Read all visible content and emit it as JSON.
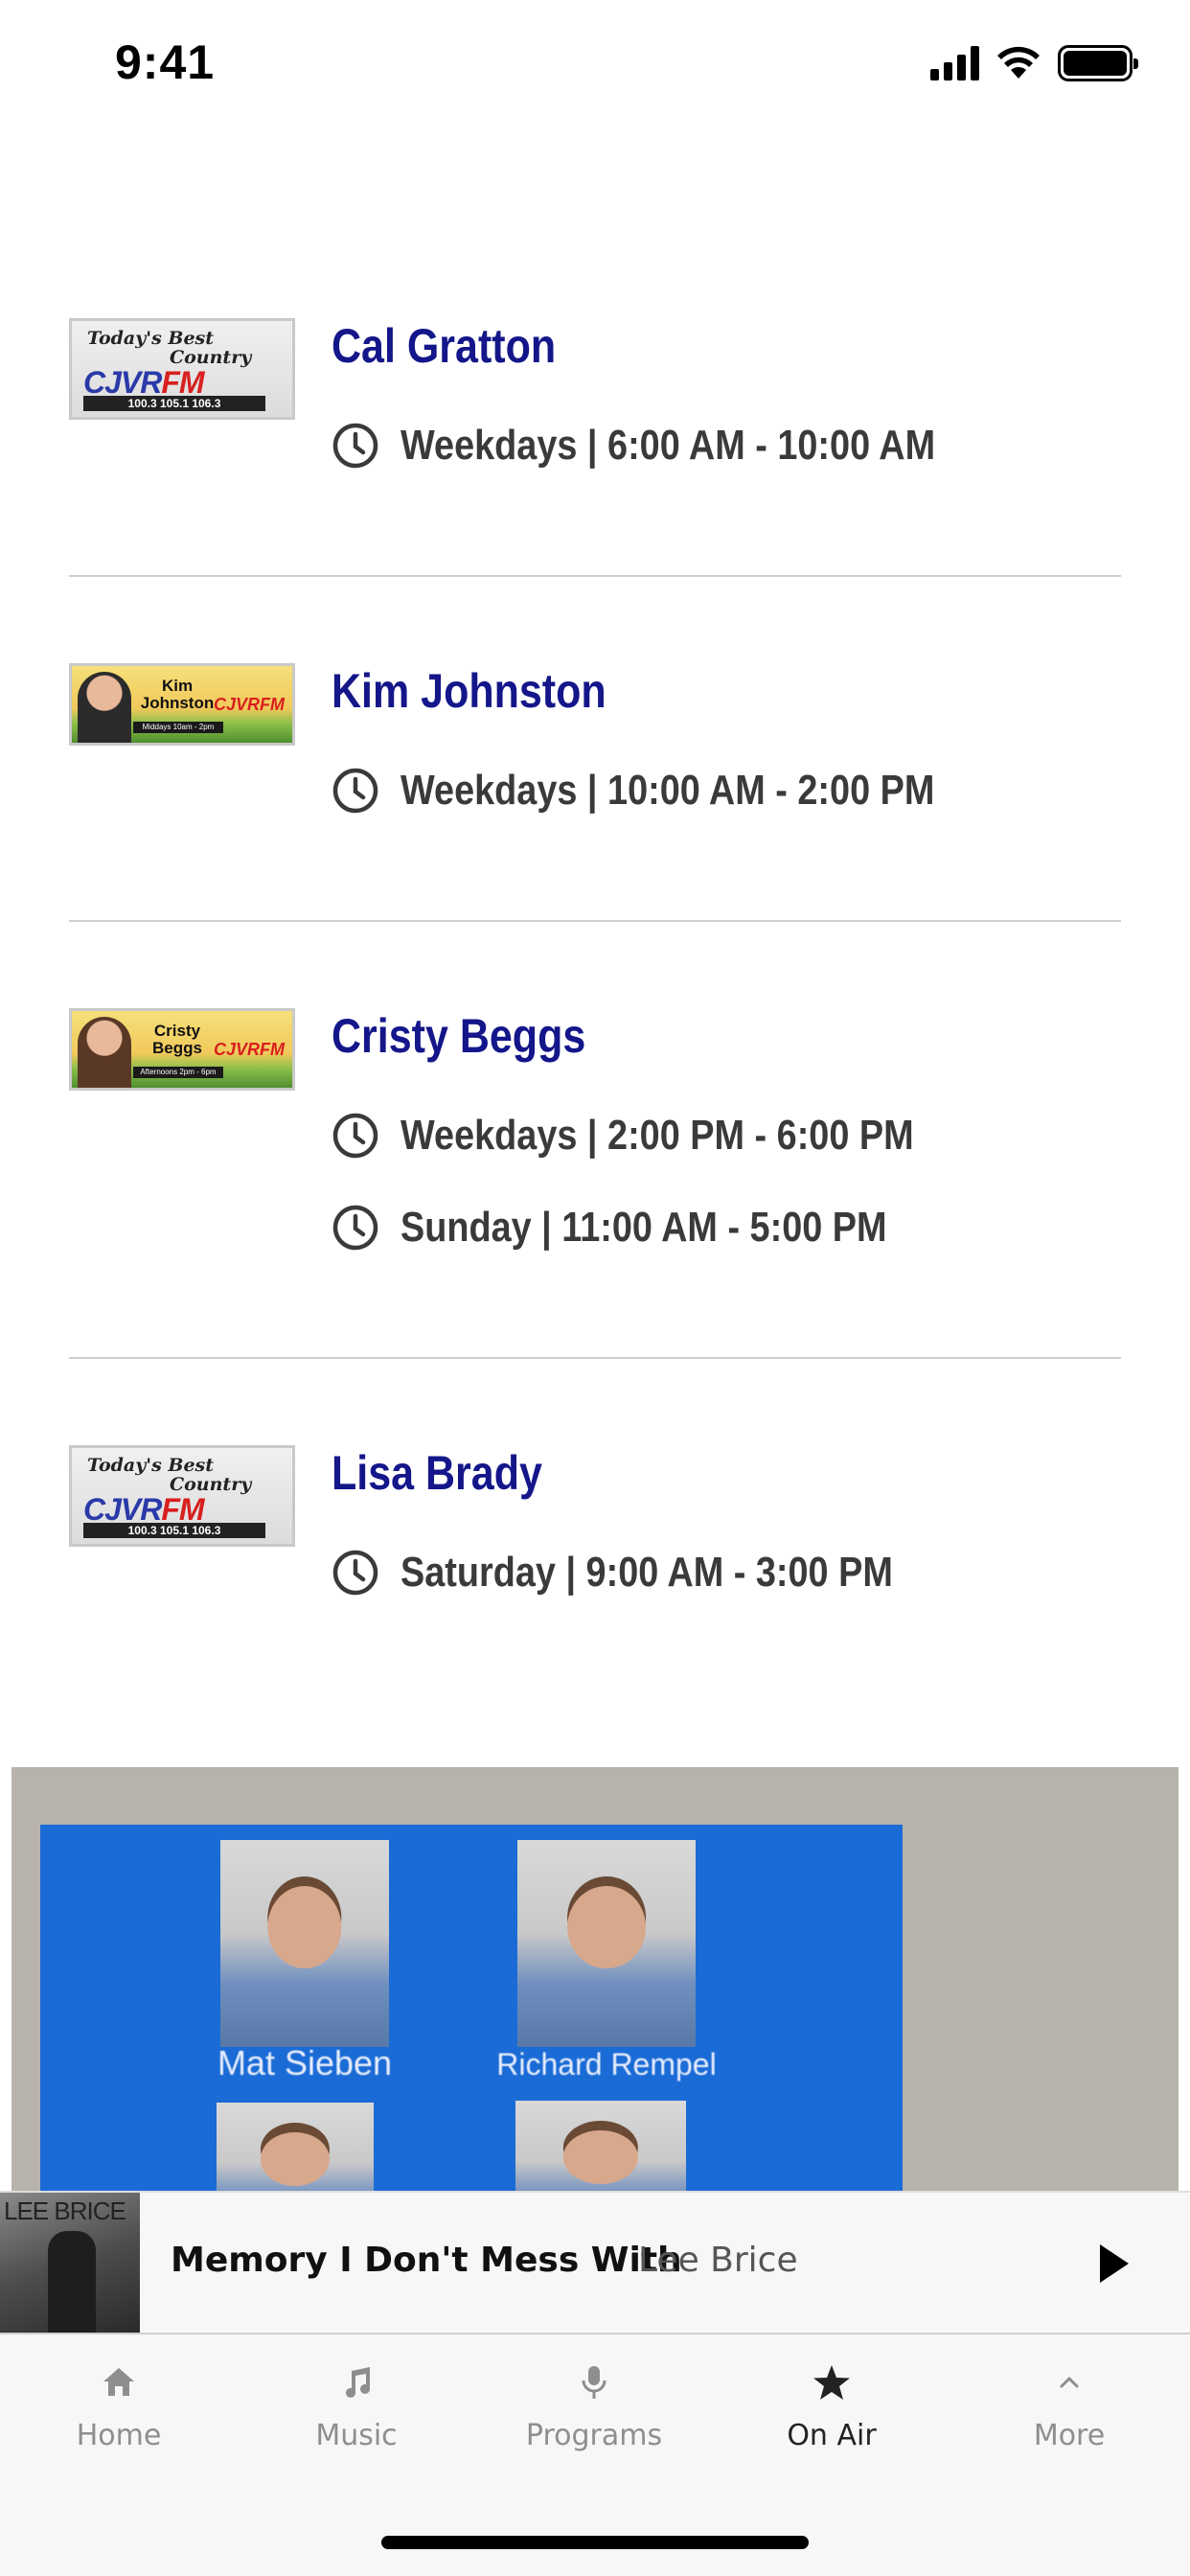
{
  "status_bar": {
    "time": "9:41"
  },
  "schedule": [
    {
      "name": "Cal Gratton",
      "thumb": "logo",
      "slots": [
        "Weekdays | 6:00 AM - 10:00 AM"
      ]
    },
    {
      "name": "Kim Johnston",
      "thumb": "banner",
      "banner_name": "Kim Johnston",
      "banner_sub": "Middays 10am - 2pm",
      "slots": [
        "Weekdays | 10:00 AM - 2:00 PM"
      ]
    },
    {
      "name": "Cristy Beggs",
      "thumb": "banner",
      "banner_name": "Cristy Beggs",
      "banner_sub": "Afternoons 2pm - 6pm",
      "slots": [
        "Weekdays | 2:00 PM - 6:00 PM",
        "Sunday | 11:00 AM - 5:00 PM"
      ]
    },
    {
      "name": "Lisa Brady",
      "thumb": "logo",
      "slots": [
        "Saturday | 9:00 AM - 3:00 PM"
      ]
    }
  ],
  "station_logo": {
    "tagline_line1": "Today's Best",
    "tagline_line2": "Country",
    "call_letters_a": "CJVR",
    "call_letters_b": "FM",
    "frequencies": "100.3  105.1  106.3"
  },
  "promo": {
    "people": [
      "Mat Sieben",
      "Richard Rempel"
    ]
  },
  "now_playing": {
    "art_text": "LEE BRICE",
    "title": "Memory I Don't Mess With",
    "artist": "Lee Brice"
  },
  "tabs": [
    {
      "label": "Home",
      "icon": "home-icon"
    },
    {
      "label": "Music",
      "icon": "music-note-icon"
    },
    {
      "label": "Programs",
      "icon": "microphone-icon"
    },
    {
      "label": "On Air",
      "icon": "star-icon",
      "active": true
    },
    {
      "label": "More",
      "icon": "chevron-up-icon"
    }
  ],
  "colors": {
    "show_name": "#14168a",
    "slot_text": "#3a3a3a",
    "promo_blue": "#1a6bd6"
  }
}
